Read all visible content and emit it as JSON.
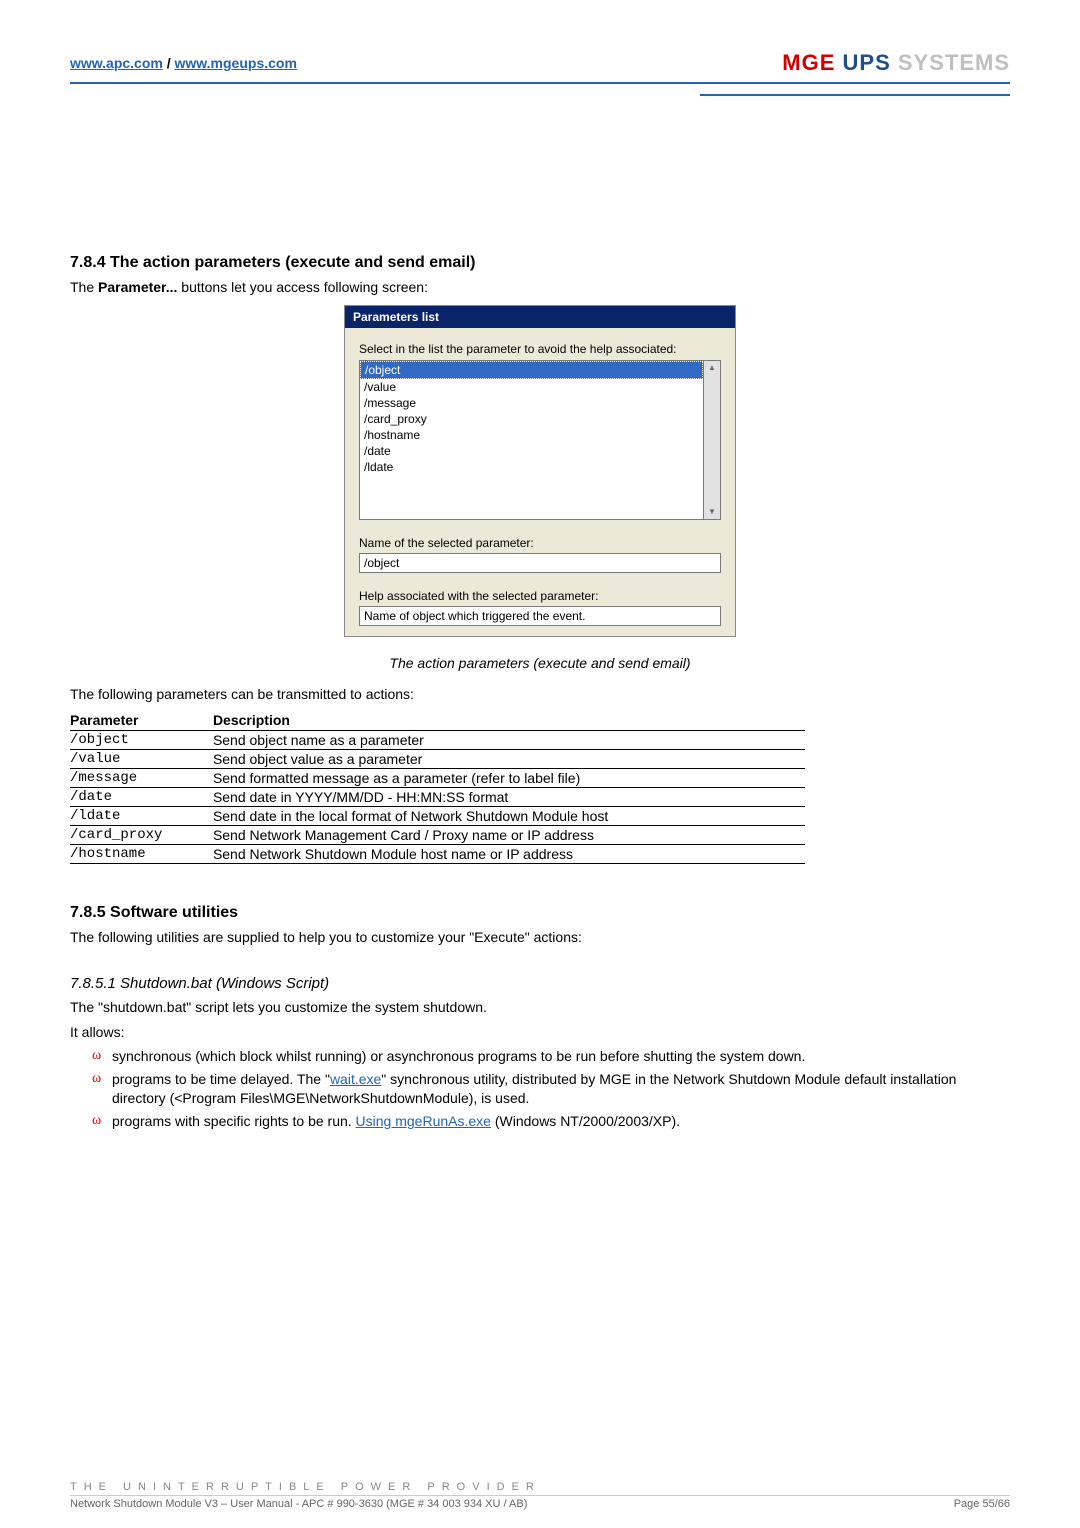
{
  "header": {
    "link1": "www.apc.com",
    "sep": " / ",
    "link2": "www.mgeups.com",
    "logo_mge": "MGE",
    "logo_ups": " UPS ",
    "logo_sys": "SYSTEMS"
  },
  "sec784": {
    "heading": "7.8.4   The action parameters  (execute and send email)",
    "intro_a": "The ",
    "intro_b": "Parameter...",
    "intro_c": " buttons let you access following screen:"
  },
  "screenshot": {
    "title": "Parameters list",
    "prompt": "Select in the list the parameter to avoid the help associated:",
    "items": [
      "/object",
      "/value",
      "/message",
      "/card_proxy",
      "/hostname",
      "/date",
      "/ldate"
    ],
    "label_selected": "Name of the selected parameter:",
    "selected_value": "/object",
    "label_help": "Help associated with the selected parameter:",
    "help_value": "Name of object which triggered the event."
  },
  "caption": "The action parameters  (execute and send email)",
  "table_intro": "The following parameters can be transmitted to actions:",
  "table": {
    "h1": "Parameter",
    "h2": "Description",
    "rows": [
      {
        "p": "/object",
        "d": "Send object name as a parameter"
      },
      {
        "p": "/value",
        "d": "Send object value as a parameter"
      },
      {
        "p": "/message",
        "d": "Send formatted message as a parameter (refer to label file)"
      },
      {
        "p": "/date",
        "d": "Send date in YYYY/MM/DD - HH:MN:SS format"
      },
      {
        "p": "/ldate",
        "d": "Send date in the local format of Network Shutdown Module host"
      },
      {
        "p": "/card_proxy",
        "d": "Send Network Management Card / Proxy name or IP address"
      },
      {
        "p": "/hostname",
        "d": "Send Network Shutdown Module host name or IP address"
      }
    ]
  },
  "sec785": {
    "heading": "7.8.5   Software utilities",
    "intro": "The following utilities are supplied to help you to customize your \"Execute\" actions:"
  },
  "sec7851": {
    "heading": "7.8.5.1   Shutdown.bat (Windows Script)",
    "p1": "The \"shutdown.bat\" script lets you customize the system shutdown.",
    "p2": "It allows:",
    "b1": "synchronous (which block whilst running) or asynchronous programs to be run before shutting the system down.",
    "b2a": "programs to be time delayed. The \"",
    "b2link": "wait.exe",
    "b2b": "\" synchronous utility, distributed by MGE in the Network Shutdown Module default installation directory (<Program Files\\MGE\\NetworkShutdownModule), is used.",
    "b3a": "programs with specific rights to be run. ",
    "b3link": "Using mgeRunAs.exe",
    "b3b": " (Windows NT/2000/2003/XP)."
  },
  "footer": {
    "tagline": "THE UNINTERRUPTIBLE POWER PROVIDER",
    "meta": "Network Shutdown Module V3 – User Manual - APC # 990-3630 (MGE # 34 003 934 XU / AB)",
    "page": "Page 55/66"
  },
  "chart_data": {
    "type": "table",
    "title": "Action parameters transmitted to actions",
    "columns": [
      "Parameter",
      "Description"
    ],
    "rows": [
      [
        "/object",
        "Send object name as a parameter"
      ],
      [
        "/value",
        "Send object value as a parameter"
      ],
      [
        "/message",
        "Send formatted message as a parameter (refer to label file)"
      ],
      [
        "/date",
        "Send date in YYYY/MM/DD - HH:MN:SS format"
      ],
      [
        "/ldate",
        "Send date in the local format of Network Shutdown Module host"
      ],
      [
        "/card_proxy",
        "Send Network Management Card / Proxy name or IP address"
      ],
      [
        "/hostname",
        "Send Network Shutdown Module host name or IP address"
      ]
    ]
  }
}
